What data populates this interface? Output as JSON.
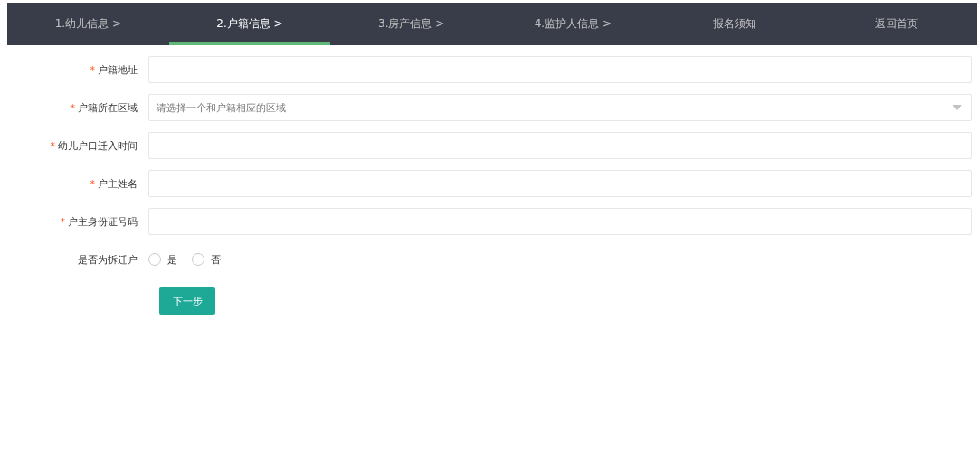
{
  "steps": [
    {
      "label": "1.幼儿信息 >",
      "selected": false
    },
    {
      "label": "2.户籍信息 >",
      "selected": true
    },
    {
      "label": "3.房产信息 >",
      "selected": false
    },
    {
      "label": "4.监护人信息 >",
      "selected": false
    },
    {
      "label": "报名须知",
      "selected": false
    },
    {
      "label": "返回首页",
      "selected": false
    }
  ],
  "fields": [
    {
      "kind": "text",
      "label": "户籍地址",
      "required": true
    },
    {
      "kind": "select",
      "label": "户籍所在区域",
      "required": true,
      "placeholder": "请选择一个和户籍相应的区域"
    },
    {
      "kind": "text",
      "label": "幼儿户口迁入时间",
      "required": true
    },
    {
      "kind": "text",
      "label": "户主姓名",
      "required": true
    },
    {
      "kind": "text",
      "label": "户主身份证号码",
      "required": true
    },
    {
      "kind": "radio",
      "label": "是否为拆迁户",
      "required": false,
      "options": [
        {
          "label": "是",
          "selected": false
        },
        {
          "label": "否",
          "selected": false
        }
      ]
    }
  ],
  "required_mark": "*",
  "next_button": "下一步"
}
